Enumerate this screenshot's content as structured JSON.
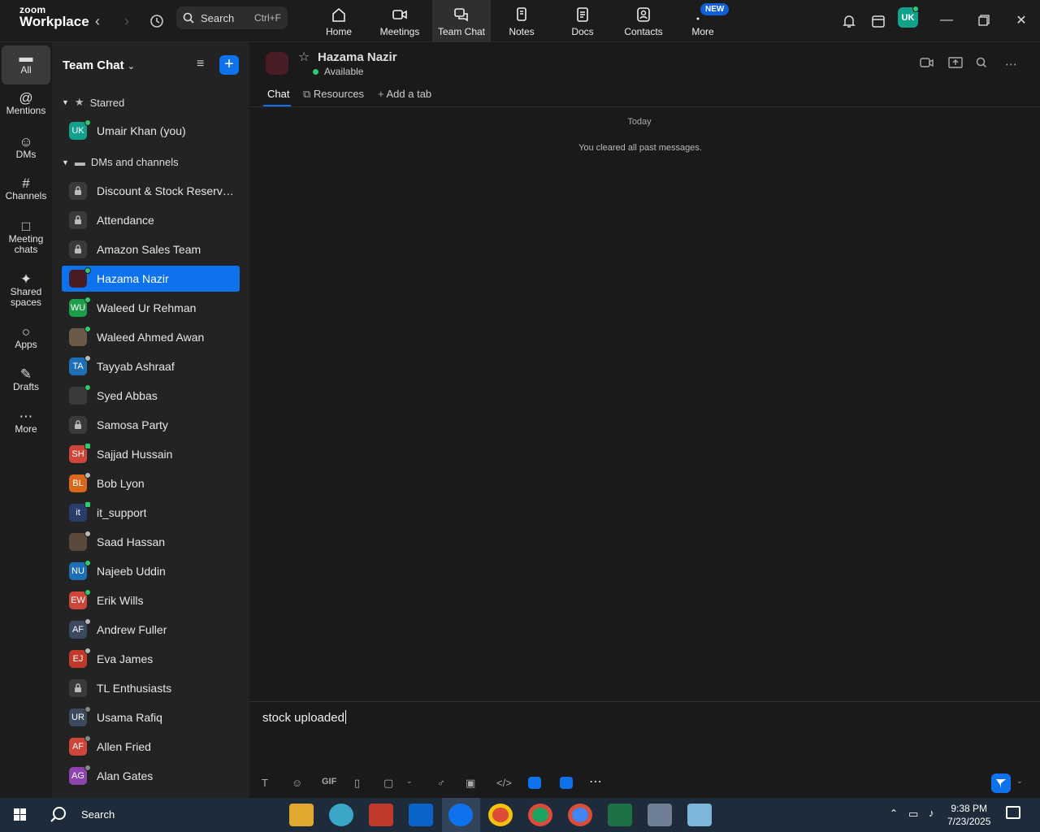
{
  "app": {
    "logo_line1": "zoom",
    "logo_line2": "Workplace"
  },
  "search": {
    "label": "Search",
    "shortcut": "Ctrl+F"
  },
  "nav": {
    "tabs": [
      {
        "label": "Home",
        "icon": "home-icon"
      },
      {
        "label": "Meetings",
        "icon": "video-icon"
      },
      {
        "label": "Team Chat",
        "icon": "chat-icon"
      },
      {
        "label": "Notes",
        "icon": "notes-icon"
      },
      {
        "label": "Docs",
        "icon": "docs-icon"
      },
      {
        "label": "Contacts",
        "icon": "contacts-icon"
      },
      {
        "label": "More",
        "icon": "more-icon"
      }
    ],
    "active": "Team Chat",
    "new_badge": "NEW"
  },
  "user": {
    "initials": "UK",
    "status_color": "#2ecc71"
  },
  "rail": {
    "items": [
      {
        "label": "All",
        "icon": "chat-bubble-icon"
      },
      {
        "label": "Mentions",
        "icon": "at-icon"
      },
      {
        "label": "DMs",
        "icon": "people-icon"
      },
      {
        "label": "Channels",
        "icon": "hash-icon"
      },
      {
        "label": "Meeting chats",
        "icon": "calendar-icon"
      },
      {
        "label": "Shared spaces",
        "icon": "share-icon"
      },
      {
        "label": "Apps",
        "icon": "apps-icon"
      },
      {
        "label": "Drafts",
        "icon": "drafts-icon"
      },
      {
        "label": "More",
        "icon": "ellipsis-icon"
      }
    ]
  },
  "sidebar": {
    "title": "Team Chat",
    "starred_label": "Starred",
    "starred": [
      {
        "name": "Umair Khan (you)",
        "initials": "UK",
        "color": "#12a18a",
        "status": "online"
      }
    ],
    "dms_label": "DMs and channels",
    "items": [
      {
        "name": "Discount & Stock Reservati...",
        "type": "lock"
      },
      {
        "name": "Attendance",
        "type": "lock"
      },
      {
        "name": "Amazon Sales Team",
        "type": "lock"
      },
      {
        "name": "Hazama Nazir",
        "initials": "",
        "color": "#4a1c26",
        "status": "online",
        "selected": true
      },
      {
        "name": "Waleed Ur Rehman",
        "initials": "WU",
        "color": "#1e9e4a",
        "status": "online"
      },
      {
        "name": "Waleed Ahmed Awan",
        "initials": "",
        "color": "#6b5a4a",
        "status": "online"
      },
      {
        "name": "Tayyab Ashraaf",
        "initials": "TA",
        "color": "#1d6fb8",
        "status": "away"
      },
      {
        "name": "Syed Abbas",
        "initials": "",
        "color": "#3a3a3a",
        "status": "online"
      },
      {
        "name": "Samosa Party",
        "type": "lock"
      },
      {
        "name": "Sajjad Hussain",
        "initials": "SH",
        "color": "#d0453a",
        "status": "mobile"
      },
      {
        "name": "Bob Lyon",
        "initials": "BL",
        "color": "#d9681c",
        "status": "away"
      },
      {
        "name": "it_support",
        "initials": "it",
        "color": "#2a3c6a",
        "status": "mobile"
      },
      {
        "name": "Saad Hassan",
        "initials": "",
        "color": "#5a4a3e",
        "status": "away"
      },
      {
        "name": "Najeeb Uddin",
        "initials": "NU",
        "color": "#1d6fb8",
        "status": "online"
      },
      {
        "name": "Erik Wills",
        "initials": "EW",
        "color": "#d0453a",
        "status": "online"
      },
      {
        "name": "Andrew Fuller",
        "initials": "AF",
        "color": "#3c4a60",
        "status": "away"
      },
      {
        "name": "Eva James",
        "initials": "EJ",
        "color": "#c0392b",
        "status": "away"
      },
      {
        "name": "TL Enthusiasts",
        "type": "lock"
      },
      {
        "name": "Usama Rafiq",
        "initials": "UR",
        "color": "#3c4a60",
        "status": "offline"
      },
      {
        "name": "Allen Fried",
        "initials": "AF",
        "color": "#d0453a",
        "status": "offline"
      },
      {
        "name": "Alan Gates",
        "initials": "AG",
        "color": "#8e44ad",
        "status": "offline"
      }
    ]
  },
  "chat": {
    "name": "Hazama Nazir",
    "status": "Available",
    "tabs": [
      "Chat",
      "Resources",
      "Add a tab"
    ],
    "day_label": "Today",
    "system_message": "You cleared all past messages.",
    "composer_text": "stock uploaded"
  },
  "taskbar": {
    "search_label": "Search",
    "time": "9:38 PM",
    "date": "7/23/2025"
  }
}
